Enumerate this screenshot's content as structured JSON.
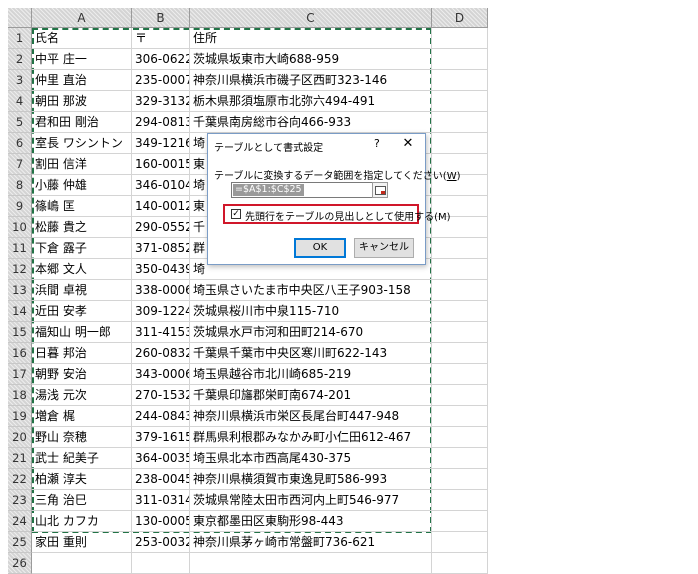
{
  "columns": [
    "A",
    "B",
    "C",
    "D"
  ],
  "header_row": {
    "num": "1",
    "a": "氏名",
    "b": "〒",
    "c": "住所"
  },
  "rows": [
    {
      "num": "2",
      "a": "中平 庄一",
      "b": "306-0622",
      "c": "茨城県坂東市大崎688-959"
    },
    {
      "num": "3",
      "a": "仲里 直治",
      "b": "235-0007",
      "c": "神奈川県横浜市磯子区西町323-146"
    },
    {
      "num": "4",
      "a": "朝田 那波",
      "b": "329-3132",
      "c": "栃木県那須塩原市北弥六494-491"
    },
    {
      "num": "5",
      "a": "君和田 剛治",
      "b": "294-0813",
      "c": "千葉県南房総市谷向466-933"
    },
    {
      "num": "6",
      "a": "室長 ワシントン",
      "b": "349-1216",
      "c": "埼"
    },
    {
      "num": "7",
      "a": "割田 信洋",
      "b": "160-0015",
      "c": "東"
    },
    {
      "num": "8",
      "a": "小藤 仲雄",
      "b": "346-0104",
      "c": "埼"
    },
    {
      "num": "9",
      "a": "篠嶋 匡",
      "b": "140-0012",
      "c": "東"
    },
    {
      "num": "10",
      "a": "松藤 貴之",
      "b": "290-0552",
      "c": "千"
    },
    {
      "num": "11",
      "a": "下倉 露子",
      "b": "371-0852",
      "c": "群"
    },
    {
      "num": "12",
      "a": "本郷 文人",
      "b": "350-0439",
      "c": "埼"
    },
    {
      "num": "13",
      "a": "浜間 卓視",
      "b": "338-0006",
      "c": "埼玉県さいたま市中央区八王子903-158"
    },
    {
      "num": "14",
      "a": "近田 安孝",
      "b": "309-1224",
      "c": "茨城県桜川市中泉115-710"
    },
    {
      "num": "15",
      "a": "福知山 明一郎",
      "b": "311-4153",
      "c": "茨城県水戸市河和田町214-670"
    },
    {
      "num": "16",
      "a": "日暮 邦治",
      "b": "260-0832",
      "c": "千葉県千葉市中央区寒川町622-143"
    },
    {
      "num": "17",
      "a": "朝野 安治",
      "b": "343-0006",
      "c": "埼玉県越谷市北川崎685-219"
    },
    {
      "num": "18",
      "a": "湯浅 元次",
      "b": "270-1532",
      "c": "千葉県印旛郡栄町南674-201"
    },
    {
      "num": "19",
      "a": "増倉 梶",
      "b": "244-0843",
      "c": "神奈川県横浜市栄区長尾台町447-948"
    },
    {
      "num": "20",
      "a": "野山 奈穂",
      "b": "379-1615",
      "c": "群馬県利根郡みなかみ町小仁田612-467"
    },
    {
      "num": "21",
      "a": "武士 紀美子",
      "b": "364-0035",
      "c": "埼玉県北本市西高尾430-375"
    },
    {
      "num": "22",
      "a": "柏瀬 淳夫",
      "b": "238-0045",
      "c": "神奈川県横須賀市東逸見町586-993"
    },
    {
      "num": "23",
      "a": "三角 治巳",
      "b": "311-0314",
      "c": "茨城県常陸太田市西河内上町546-977"
    },
    {
      "num": "24",
      "a": "山北 カフカ",
      "b": "130-0005",
      "c": "東京都墨田区東駒形98-443"
    },
    {
      "num": "25",
      "a": "家田 重則",
      "b": "253-0032",
      "c": "神奈川県茅ヶ崎市常盤町736-621"
    },
    {
      "num": "26",
      "a": "",
      "b": "",
      "c": ""
    }
  ],
  "dialog": {
    "title": "テーブルとして書式設定",
    "help": "?",
    "close": "✕",
    "prompt": "テーブルに変換するデータ範囲を指定してください(",
    "prompt_key": "W",
    "prompt_end": ")",
    "range_value": "=$A$1:$C$25",
    "checkbox_mark": "✓",
    "checkbox_label": "先頭行をテーブルの見出しとして使用する(M)",
    "ok": "OK",
    "cancel": "キャンセル"
  },
  "colors": {
    "marquee": "#217346",
    "highlight": "#d0172a",
    "ok_border": "#0078d7"
  }
}
